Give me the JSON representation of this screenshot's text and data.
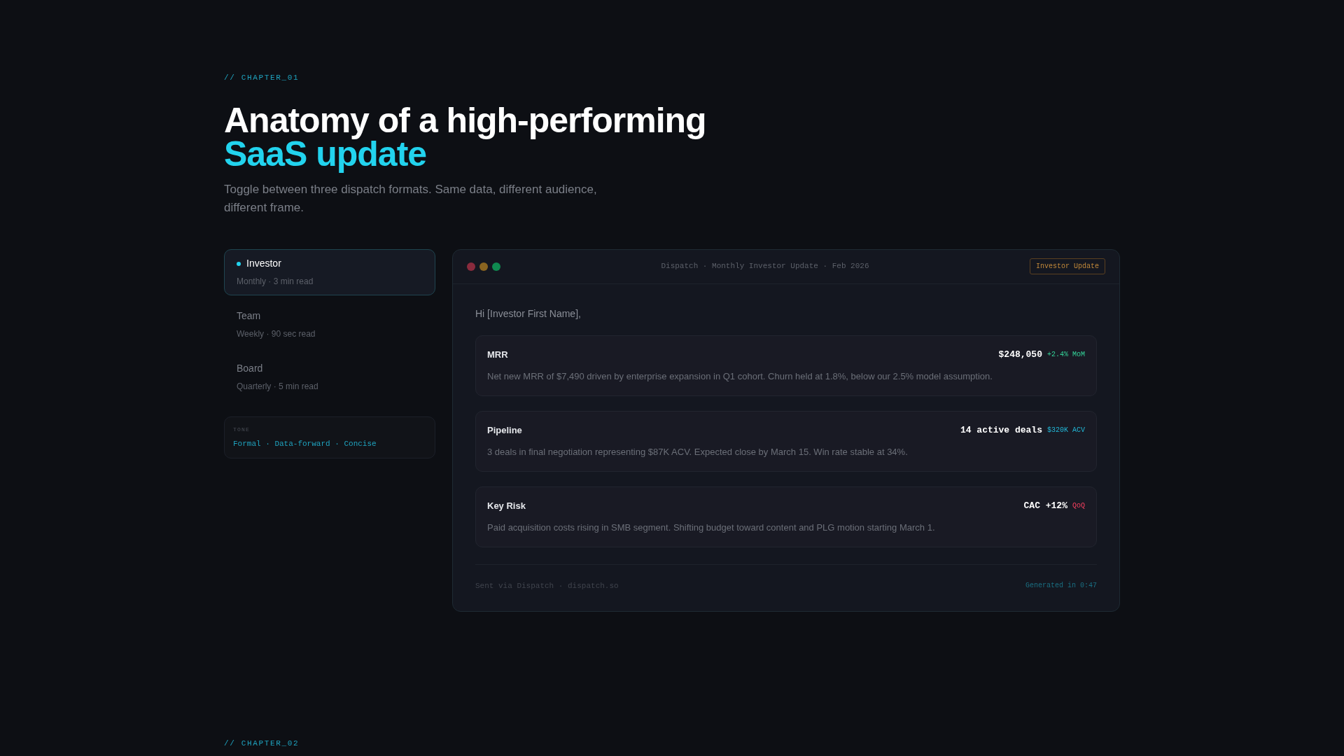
{
  "chapter_label": "// CHAPTER_01",
  "heading": {
    "line_1": "Anatomy of a high-performing",
    "line_2": "SaaS update"
  },
  "subtitle": "Toggle between three dispatch formats. Same data, different audience, different frame.",
  "formats": [
    {
      "name": "Investor",
      "detail": "Monthly · 3 min read",
      "selected": true
    },
    {
      "name": "Team",
      "detail": "Weekly · 90 sec read",
      "selected": false
    },
    {
      "name": "Board",
      "detail": "Quarterly · 5 min read",
      "selected": false
    }
  ],
  "tone": {
    "label": "TONE",
    "value": "Formal · Data-forward · Concise"
  },
  "preview": {
    "title": "Dispatch · Monthly Investor Update · Feb 2026",
    "badge": "Investor Update",
    "greeting": "Hi [Investor First Name],",
    "metrics": [
      {
        "label": "MRR",
        "value": "$248,050",
        "delta": "+2.4% MoM",
        "kind": "positive",
        "note": "Net new MRR of $7,490 driven by enterprise expansion in Q1 cohort. Churn held at 1.8%, below our 2.5% model assumption."
      },
      {
        "label": "Pipeline",
        "value": "14 active deals",
        "delta": "$320K ACV",
        "kind": "info",
        "note": "3 deals in final negotiation representing $87K ACV. Expected close by March 15. Win rate stable at 34%."
      },
      {
        "label": "Key Risk",
        "value": "CAC +12%",
        "delta": "QoQ",
        "kind": "negative",
        "note": "Paid acquisition costs rising in SMB segment. Shifting budget toward content and PLG motion starting March 1."
      }
    ],
    "footer_left": "Sent via Dispatch · dispatch.so",
    "footer_right": "Generated in 0:47"
  },
  "next_chapter_label": "// CHAPTER_02"
}
